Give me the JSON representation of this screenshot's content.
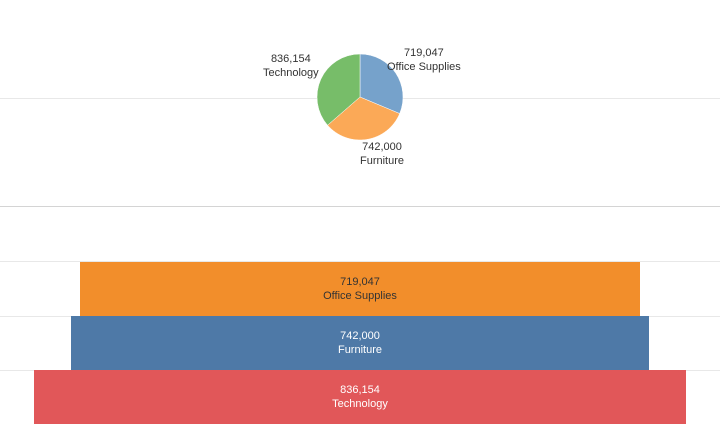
{
  "chart_data": [
    {
      "type": "pie",
      "slices": [
        {
          "category": "Office Supplies",
          "value": 719047,
          "value_label": "719,047",
          "color": "#76a2cb"
        },
        {
          "category": "Furniture",
          "value": 742000,
          "value_label": "742,000",
          "color": "#fba957"
        },
        {
          "category": "Technology",
          "value": 836154,
          "value_label": "836,154",
          "color": "#77bd69"
        }
      ]
    },
    {
      "type": "bar",
      "orientation": "funnel",
      "bars": [
        {
          "category": "Office Supplies",
          "value": 719047,
          "value_label": "719,047",
          "color": "#f28e2b",
          "text_color": "#333333"
        },
        {
          "category": "Furniture",
          "value": 742000,
          "value_label": "742,000",
          "color": "#4e79a7",
          "text_color": "#ffffff"
        },
        {
          "category": "Technology",
          "value": 836154,
          "value_label": "836,154",
          "color": "#e15759",
          "text_color": "#ffffff"
        }
      ]
    }
  ]
}
